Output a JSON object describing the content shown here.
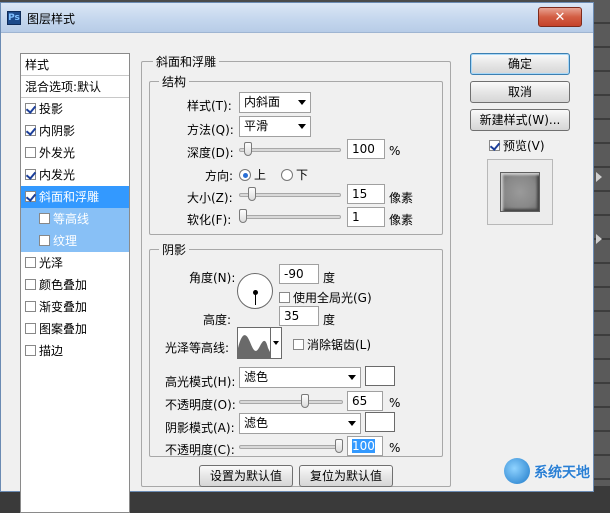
{
  "window": {
    "title": "图层样式",
    "close_label": "✕"
  },
  "styles_list": {
    "header": "样式",
    "items": [
      {
        "label": "混合选项:默认",
        "checkbox": false,
        "checked": false
      },
      {
        "label": "投影",
        "checkbox": true,
        "checked": true
      },
      {
        "label": "内阴影",
        "checkbox": true,
        "checked": true
      },
      {
        "label": "外发光",
        "checkbox": true,
        "checked": false
      },
      {
        "label": "内发光",
        "checkbox": true,
        "checked": true
      },
      {
        "label": "斜面和浮雕",
        "checkbox": true,
        "checked": true
      },
      {
        "label": "等高线",
        "checkbox": true,
        "checked": false
      },
      {
        "label": "纹理",
        "checkbox": true,
        "checked": false
      },
      {
        "label": "光泽",
        "checkbox": true,
        "checked": false
      },
      {
        "label": "颜色叠加",
        "checkbox": true,
        "checked": false
      },
      {
        "label": "渐变叠加",
        "checkbox": true,
        "checked": false
      },
      {
        "label": "图案叠加",
        "checkbox": true,
        "checked": false
      },
      {
        "label": "描边",
        "checkbox": true,
        "checked": false
      }
    ]
  },
  "bevel": {
    "title": "斜面和浮雕",
    "structure": {
      "title": "结构",
      "style_label": "样式(T):",
      "style_value": "内斜面",
      "technique_label": "方法(Q):",
      "technique_value": "平滑",
      "depth_label": "深度(D):",
      "depth_value": "100",
      "depth_unit": "%",
      "depth_level": 0.05,
      "direction_label": "方向:",
      "direction_up": "上",
      "direction_down": "下",
      "size_label": "大小(Z):",
      "size_value": "15",
      "size_unit": "像素",
      "size_level": 0.1,
      "soften_label": "软化(F):",
      "soften_value": "1",
      "soften_unit": "像素",
      "soften_level": 0.0
    },
    "shading": {
      "title": "阴影",
      "angle_label": "角度(N):",
      "angle_value": "-90",
      "angle_unit": "度",
      "global_light_label": "使用全局光(G)",
      "altitude_label": "高度:",
      "altitude_value": "35",
      "altitude_unit": "度",
      "gloss_contour_label": "光泽等高线:",
      "anti_alias_label": "消除锯齿(L)",
      "highlight_mode_label": "高光模式(H):",
      "highlight_mode_value": "滤色",
      "highlight_color": "#ffffff",
      "highlight_opacity_label": "不透明度(O):",
      "highlight_opacity_value": "65",
      "highlight_opacity_unit": "%",
      "highlight_opacity_level": 0.65,
      "shadow_mode_label": "阴影模式(A):",
      "shadow_mode_value": "滤色",
      "shadow_color": "#ffffff",
      "shadow_opacity_label": "不透明度(C):",
      "shadow_opacity_value": "100",
      "shadow_opacity_unit": "%",
      "shadow_opacity_level": 1.0
    },
    "make_default_label": "设置为默认值",
    "reset_default_label": "复位为默认值"
  },
  "buttons": {
    "ok": "确定",
    "cancel": "取消",
    "new_style": "新建样式(W)...",
    "preview_label": "预览(V)"
  },
  "watermark": "系统天地"
}
